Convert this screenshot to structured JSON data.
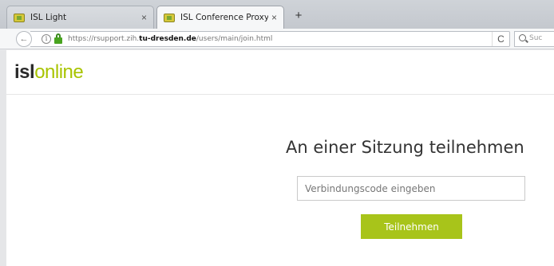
{
  "browser": {
    "tabs": [
      {
        "label": "ISL Light",
        "close": "×",
        "active": false
      },
      {
        "label": "ISL Conference Proxy",
        "close": "×",
        "active": true
      }
    ],
    "new_tab": "+",
    "back": "←",
    "info": "i",
    "url_prefix": "https://rsupport.zih.",
    "url_domain": "tu-dresden.de",
    "url_path": "/users/main/join.html",
    "reload": "C",
    "search_placeholder": "Suc"
  },
  "page": {
    "logo": {
      "part1": "isl",
      "part2": "online",
      "accent_color": "#a8c400"
    },
    "heading": "An einer Sitzung teilnehmen",
    "code_input": {
      "placeholder": "Verbindungscode eingeben",
      "value": ""
    },
    "join_button": "Teilnehmen",
    "button_color": "#a8c41a"
  }
}
